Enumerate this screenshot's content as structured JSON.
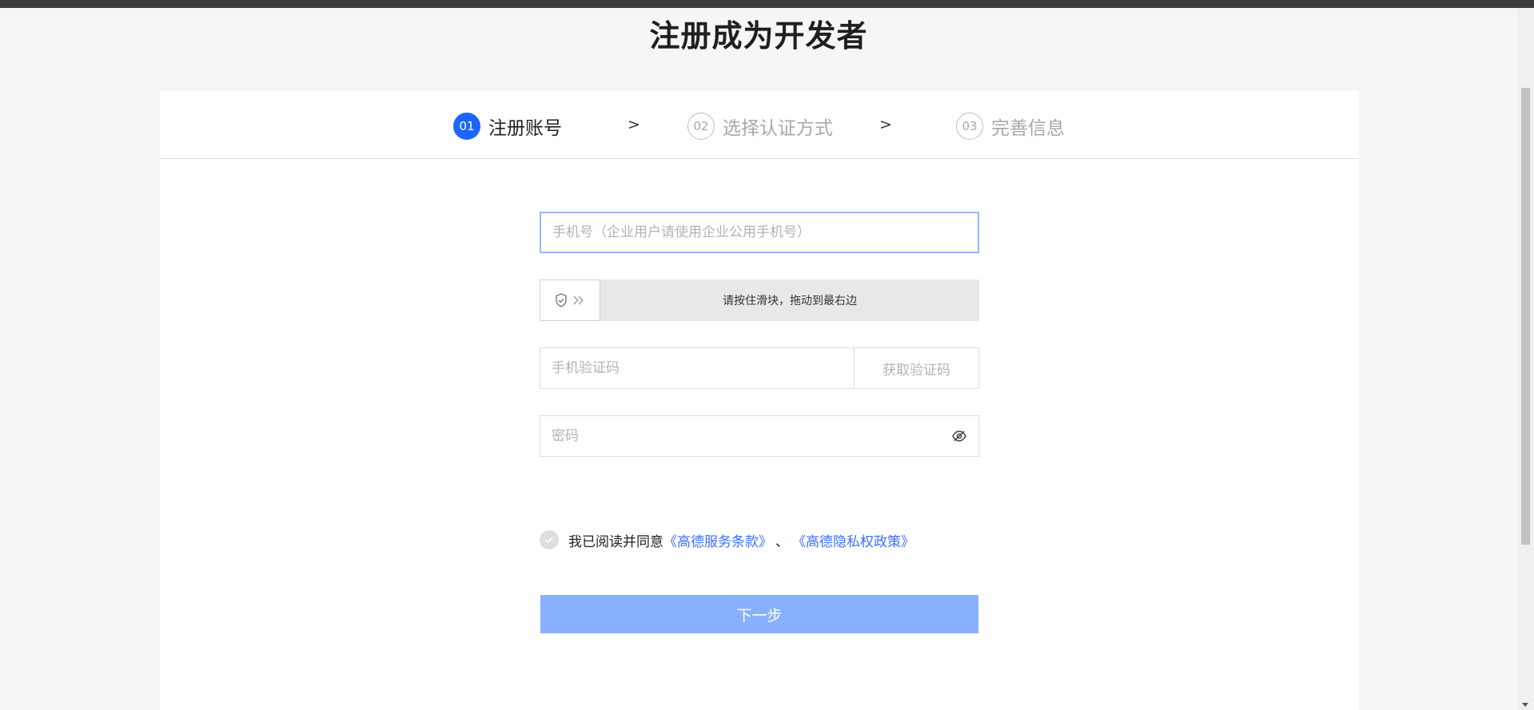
{
  "page_title": "注册成为开发者",
  "steps": [
    {
      "num": "01",
      "label": "注册账号",
      "active": true
    },
    {
      "num": "02",
      "label": "选择认证方式",
      "active": false
    },
    {
      "num": "03",
      "label": "完善信息",
      "active": false
    }
  ],
  "step_separator": ">",
  "form": {
    "phone_placeholder": "手机号（企业用户请使用企业公用手机号）",
    "slider_text": "请按住滑块，拖动到最右边",
    "sms_code_placeholder": "手机验证码",
    "get_code_label": "获取验证码",
    "password_placeholder": "密码"
  },
  "agreement": {
    "text": "我已阅读并同意",
    "link_terms": "《高德服务条款》",
    "separator": "、",
    "link_privacy": "《高德隐私权政策》"
  },
  "next_button": "下一步",
  "colors": {
    "accent": "#1a66ff",
    "link": "#3d6fff",
    "button_disabled": "#89b0ff"
  },
  "icons": {
    "slider_handle": [
      "shield-check-icon",
      "double-chevron-right-icon"
    ],
    "password_toggle": "eye-slash-icon",
    "agree_checkbox": "check-icon"
  }
}
